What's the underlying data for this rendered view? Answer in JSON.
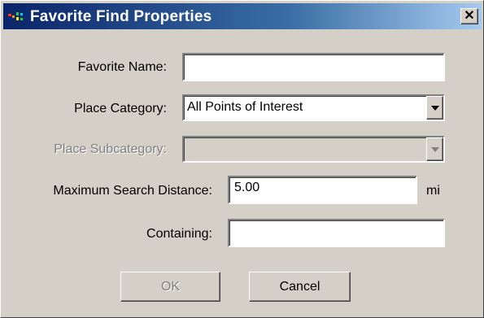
{
  "window": {
    "title": "Favorite Find Properties",
    "close_symbol": "✕",
    "app_icon": "app-icon"
  },
  "form": {
    "favorite_name": {
      "label": "Favorite Name:",
      "value": ""
    },
    "place_category": {
      "label": "Place Category:",
      "value": "All Points of Interest"
    },
    "place_subcategory": {
      "label": "Place Subcategory:",
      "value": "",
      "disabled": true
    },
    "max_distance": {
      "label": "Maximum Search Distance:",
      "value": "5.00",
      "unit": "mi"
    },
    "containing": {
      "label": "Containing:",
      "value": ""
    }
  },
  "buttons": {
    "ok": {
      "label": "OK",
      "disabled": true
    },
    "cancel": {
      "label": "Cancel"
    }
  },
  "colors": {
    "titlebar_start": "#0a246a",
    "titlebar_end": "#a6caf0",
    "face": "#d4d0c8"
  }
}
